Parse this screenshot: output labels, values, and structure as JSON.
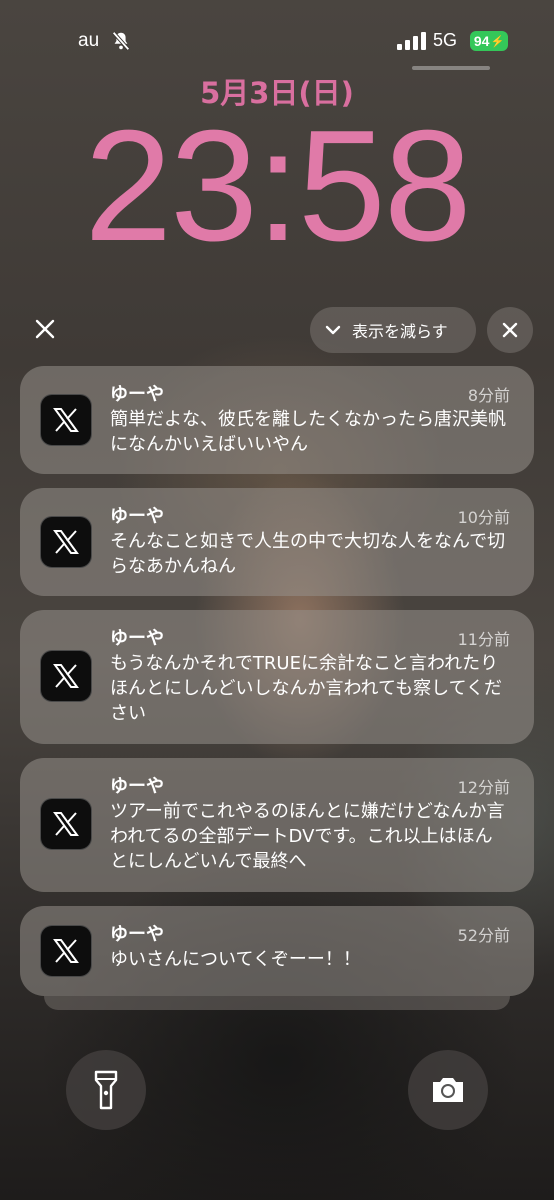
{
  "status_bar": {
    "carrier": "au",
    "network": "5G",
    "battery": "94",
    "mute_icon": "bell-slash-icon",
    "signal_icon": "signal-bars-icon"
  },
  "lock_screen": {
    "date": "5月3日(日)",
    "time": "23:58"
  },
  "notification_header": {
    "close_label": "X",
    "show_less_label": "表示を減らす",
    "show_less_icon": "chevron-down-icon",
    "clear_icon": "close-icon"
  },
  "notifications": [
    {
      "app_icon": "x-logo-icon",
      "sender": "ゆーや",
      "time_ago": "8分前",
      "message": "簡単だよな、彼氏を離したくなかったら唐沢美帆になんかいえばいいやん"
    },
    {
      "app_icon": "x-logo-icon",
      "sender": "ゆーや",
      "time_ago": "10分前",
      "message": "そんなこと如きで人生の中で大切な人をなんで切らなあかんねん"
    },
    {
      "app_icon": "x-logo-icon",
      "sender": "ゆーや",
      "time_ago": "11分前",
      "message": "もうなんかそれでTRUEに余計なこと言われたりほんとにしんどいしなんか言われても察してください"
    },
    {
      "app_icon": "x-logo-icon",
      "sender": "ゆーや",
      "time_ago": "12分前",
      "message": "ツアー前でこれやるのほんとに嫌だけどなんか言われてるの全部デートDVです。これ以上はほんとにしんどいんで最終へ"
    },
    {
      "app_icon": "x-logo-icon",
      "sender": "ゆーや",
      "time_ago": "52分前",
      "message": "ゆいさんについてくぞーー！！"
    }
  ],
  "bottom_controls": {
    "left_icon": "flashlight-icon",
    "right_icon": "camera-icon"
  },
  "colors": {
    "clock": "#e07aa8",
    "battery": "#34c759"
  }
}
